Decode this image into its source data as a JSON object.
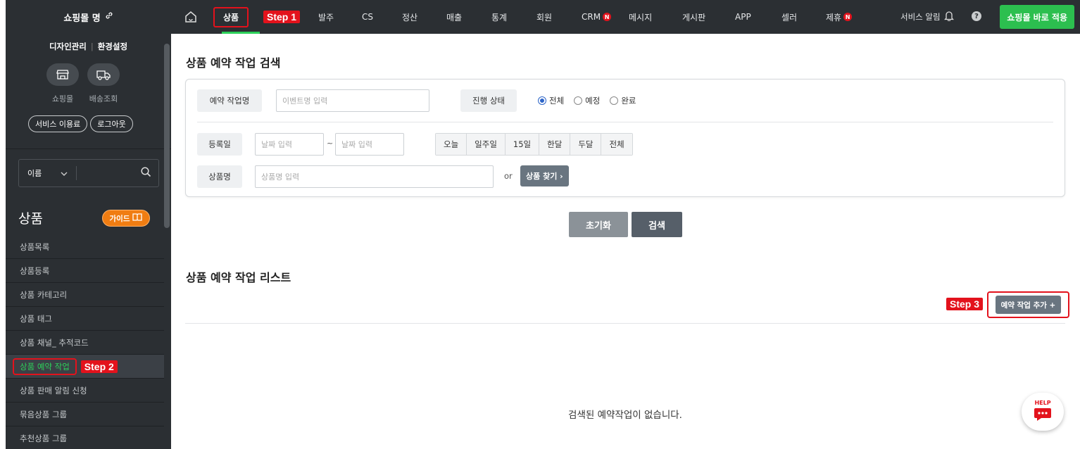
{
  "brand": {
    "name": "쇼핑몰 명"
  },
  "sidebar": {
    "links": [
      "디자인관리",
      "환경설정"
    ],
    "quick": [
      {
        "label": "쇼핑몰",
        "icon": "store-icon"
      },
      {
        "label": "배송조회",
        "icon": "truck-icon"
      }
    ],
    "pills": [
      "서비스 이용료",
      "로그아웃"
    ],
    "search_select": "이름",
    "section_title": "상품",
    "guide_label": "가이드",
    "menu": [
      "상품목록",
      "상품등록",
      "상품 카테고리",
      "상품 태그",
      "상품 채널_ 추적코드",
      "상품 예약 작업",
      "상품 판매 알림 신청",
      "묶음상품 그룹",
      "추천상품 그룹"
    ],
    "active_index": 5
  },
  "topnav": {
    "items": [
      "상품",
      "발주",
      "CS",
      "정산",
      "매출",
      "통계",
      "회원",
      "CRM",
      "메시지",
      "게시판",
      "APP",
      "셀러",
      "제휴"
    ],
    "badge": "N",
    "alert_label": "서비스 알림",
    "help_label": "?",
    "apply_label": "쇼핑몰 바로 적용"
  },
  "steps": {
    "s1": "Step 1",
    "s2": "Step 2",
    "s3": "Step 3"
  },
  "search": {
    "title": "상품 예약 작업 검색",
    "job_label": "예약 작업명",
    "job_placeholder": "이벤트명 입력",
    "status_label": "진행 상태",
    "status_options": [
      "전체",
      "예정",
      "완료"
    ],
    "date_label": "등록일",
    "date_placeholder": "날짜 입력",
    "tilde": "~",
    "periods": [
      "오늘",
      "일주일",
      "15일",
      "한달",
      "두달",
      "전체"
    ],
    "product_label": "상품명",
    "product_placeholder": "상품명 입력",
    "or": "or",
    "find_label": "상품 찾기 ›",
    "reset_label": "초기화",
    "search_label": "검색"
  },
  "list": {
    "title": "상품 예약 작업 리스트",
    "add_label": "예약 작업 추가 +",
    "empty": "검색된 예약작업이 없습니다."
  },
  "help_fab": {
    "label": "HELP"
  },
  "colors": {
    "accent_green": "#2cd05a",
    "step_red": "#e3121c",
    "dark_bg": "#2b2f33",
    "guide_orange": "#f07d12"
  }
}
